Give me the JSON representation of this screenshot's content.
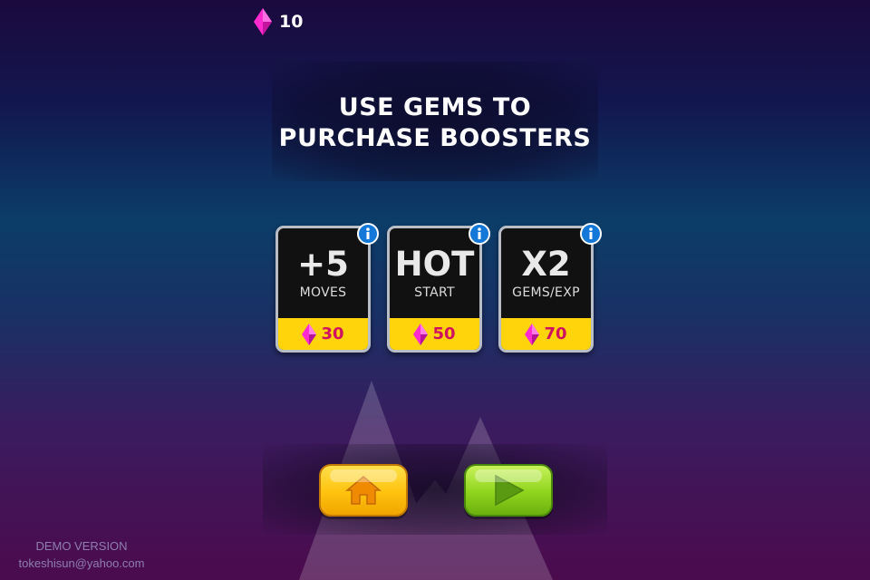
{
  "hud": {
    "gem_count": "10",
    "gem_icon": "pink-diamond-gem"
  },
  "dialog": {
    "title_line1": "USE GEMS TO",
    "title_line2": "PURCHASE BOOSTERS"
  },
  "boosters": [
    {
      "main": "+5",
      "sub": "MOVES",
      "price": "30",
      "info_icon": "info-i"
    },
    {
      "main": "HOT",
      "sub": "START",
      "price": "50",
      "info_icon": "info-i"
    },
    {
      "main": "X2",
      "sub": "GEMS/EXP",
      "price": "70",
      "info_icon": "info-i"
    }
  ],
  "buttons": {
    "home_icon": "house",
    "play_icon": "play-triangle"
  },
  "footer": {
    "demo": "DEMO VERSION",
    "email": "tokeshisun@yahoo.com"
  },
  "colors": {
    "gem": "#ff2ad0",
    "price_bar": "#ffd40a",
    "price_text": "#d1105f",
    "info_badge": "#1478d8",
    "home_button": "#ffc20e",
    "play_button": "#8fd41c"
  }
}
